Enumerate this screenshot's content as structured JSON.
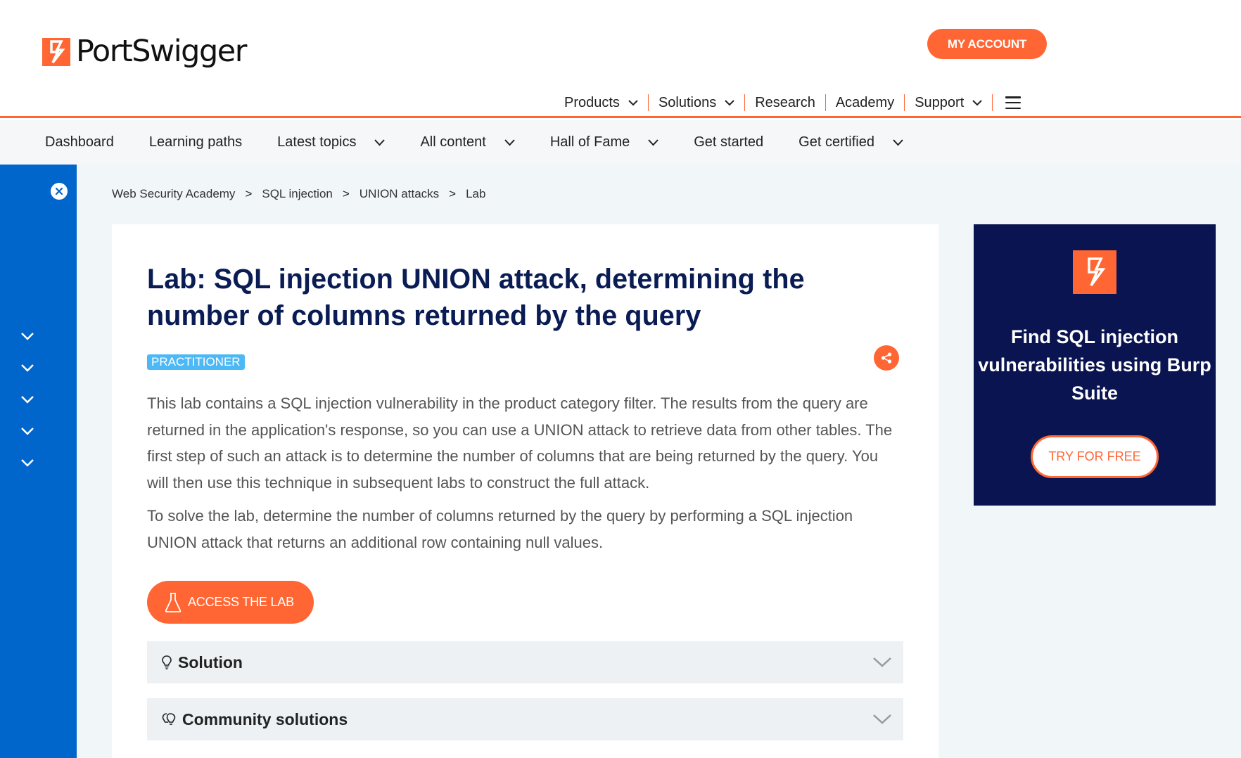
{
  "brand": {
    "name": "PortSwigger",
    "accent": "#ff6633",
    "sidebar_color": "#0066cc",
    "title_color": "#0a1c54"
  },
  "header": {
    "account_button": "MY ACCOUNT",
    "nav": [
      {
        "label": "Products",
        "icon": "chevron-down-icon"
      },
      {
        "label": "Solutions",
        "icon": "chevron-down-icon"
      },
      {
        "label": "Research"
      },
      {
        "label": "Academy"
      },
      {
        "label": "Support",
        "icon": "chevron-down-icon"
      }
    ],
    "menu_icon": "hamburger-icon"
  },
  "subnav": [
    {
      "label": "Dashboard"
    },
    {
      "label": "Learning paths"
    },
    {
      "label": "Latest topics",
      "icon": "chevron-down-icon"
    },
    {
      "label": "All content",
      "icon": "chevron-down-icon"
    },
    {
      "label": "Hall of Fame",
      "icon": "chevron-down-icon"
    },
    {
      "label": "Get started"
    },
    {
      "label": "Get certified",
      "icon": "chevron-down-icon"
    }
  ],
  "sidebar": {
    "close_icon": "close-icon",
    "expand_icons": [
      "chevron-down-icon",
      "chevron-down-icon",
      "chevron-down-icon",
      "chevron-down-icon",
      "chevron-down-icon"
    ]
  },
  "breadcrumb": [
    "Web Security Academy",
    "SQL injection",
    "UNION attacks",
    "Lab"
  ],
  "breadcrumb_sep": ">",
  "lab": {
    "title": "Lab: SQL injection UNION attack, determining the number of columns returned by the query",
    "level": "PRACTITIONER",
    "share_icon": "share-icon",
    "description_1": "This lab contains a SQL injection vulnerability in the product category filter. The results from the query are returned in the application's response, so you can use a UNION attack to retrieve data from other tables. The first step of such an attack is to determine the number of columns that are being returned by the query. You will then use this technique in subsequent labs to construct the full attack.",
    "description_2": "To solve the lab, determine the number of columns returned by the query by performing a SQL injection UNION attack that returns an additional row containing null values.",
    "access_button": "ACCESS THE LAB",
    "access_icon": "flask-icon",
    "accordions": [
      {
        "label": "Solution",
        "icon": "lightbulb-icon"
      },
      {
        "label": "Community solutions",
        "icon": "lightbulbs-icon"
      }
    ]
  },
  "ad": {
    "text": "Find SQL injection vulnerabilities using Burp Suite",
    "button": "TRY FOR FREE",
    "bg": "#0a1450"
  }
}
